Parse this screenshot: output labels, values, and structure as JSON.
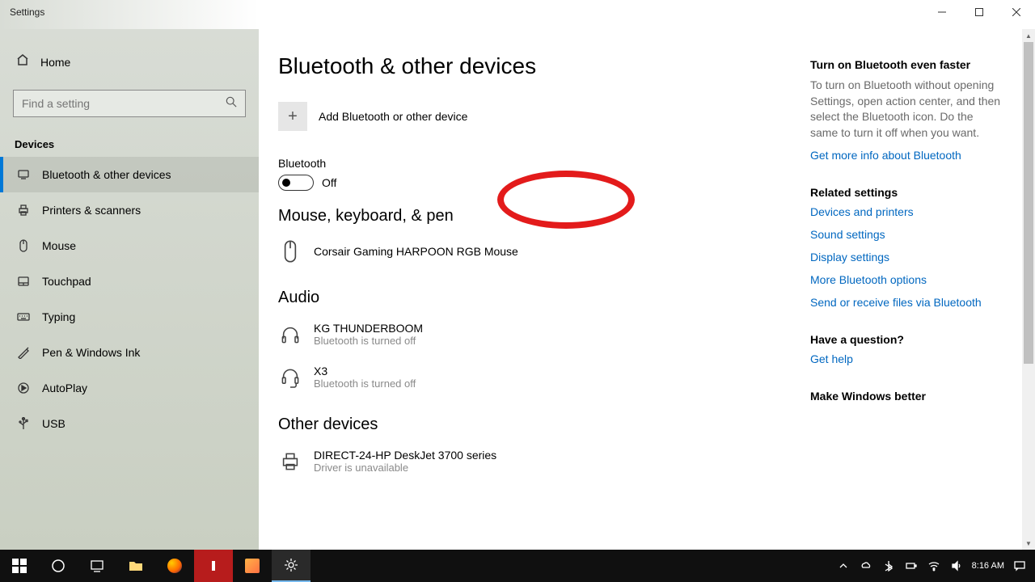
{
  "window": {
    "title": "Settings"
  },
  "sidebar": {
    "home": "Home",
    "search_placeholder": "Find a setting",
    "section": "Devices",
    "items": [
      {
        "label": "Bluetooth & other devices",
        "active": true
      },
      {
        "label": "Printers & scanners"
      },
      {
        "label": "Mouse"
      },
      {
        "label": "Touchpad"
      },
      {
        "label": "Typing"
      },
      {
        "label": "Pen & Windows Ink"
      },
      {
        "label": "AutoPlay"
      },
      {
        "label": "USB"
      }
    ]
  },
  "page": {
    "title": "Bluetooth & other devices",
    "add_label": "Add Bluetooth or other device",
    "bt_section": "Bluetooth",
    "bt_state": "Off",
    "categories": [
      {
        "title": "Mouse, keyboard, & pen",
        "devices": [
          {
            "name": "Corsair Gaming HARPOON RGB Mouse",
            "status": ""
          }
        ]
      },
      {
        "title": "Audio",
        "devices": [
          {
            "name": "KG THUNDERBOOM",
            "status": "Bluetooth is turned off"
          },
          {
            "name": "X3",
            "status": "Bluetooth is turned off"
          }
        ]
      },
      {
        "title": "Other devices",
        "devices": [
          {
            "name": "DIRECT-24-HP DeskJet 3700 series",
            "status": "Driver is unavailable"
          }
        ]
      }
    ]
  },
  "right": {
    "tip_title": "Turn on Bluetooth even faster",
    "tip_body": "To turn on Bluetooth without opening Settings, open action center, and then select the Bluetooth icon. Do the same to turn it off when you want.",
    "tip_link": "Get more info about Bluetooth",
    "related_title": "Related settings",
    "related_links": [
      "Devices and printers",
      "Sound settings",
      "Display settings",
      "More Bluetooth options",
      "Send or receive files via Bluetooth"
    ],
    "question_title": "Have a question?",
    "question_link": "Get help",
    "improve_title": "Make Windows better"
  },
  "taskbar": {
    "time": "8:16 AM"
  }
}
